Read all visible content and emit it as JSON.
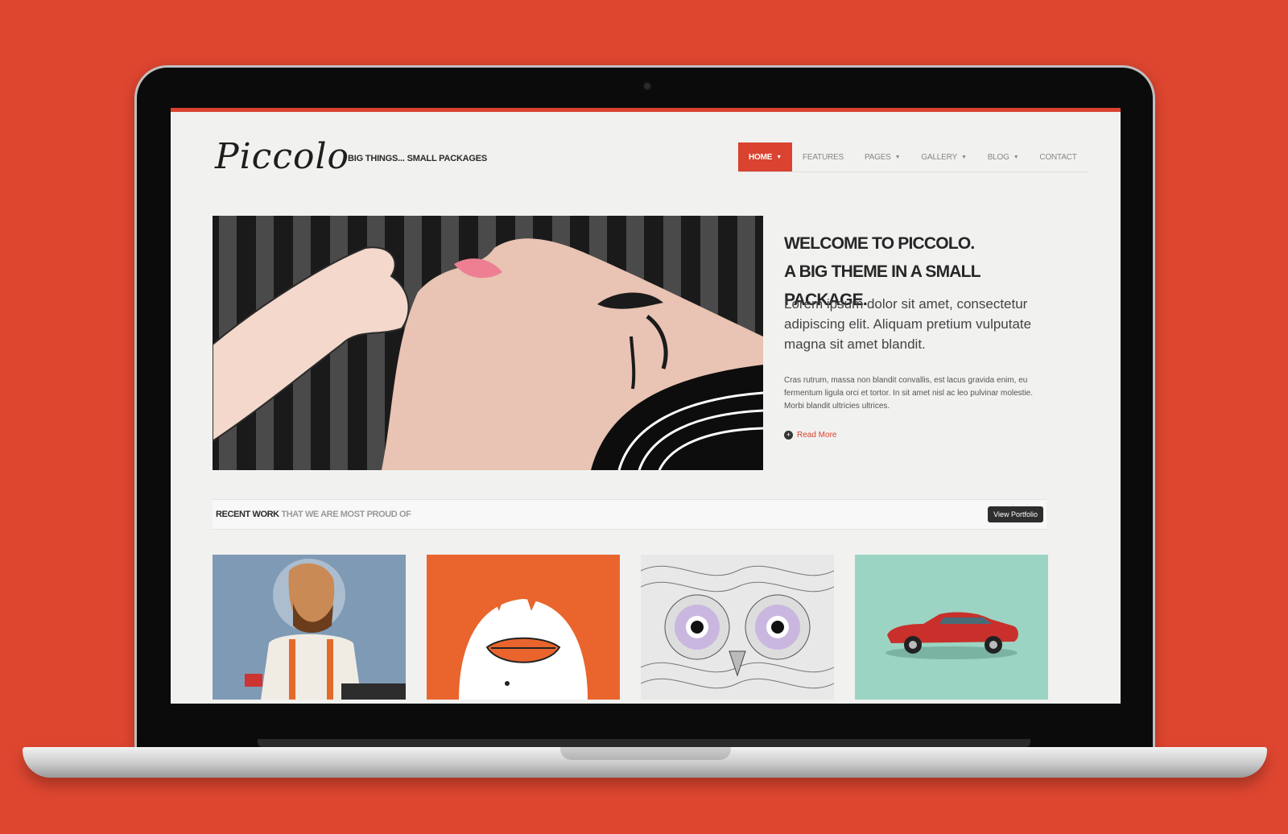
{
  "site": {
    "logo": "Piccolo",
    "tagline": "BIG THINGS... SMALL PACKAGES"
  },
  "nav": {
    "items": [
      {
        "label": "HOME",
        "active": true,
        "dropdown": true
      },
      {
        "label": "FEATURES",
        "active": false,
        "dropdown": false
      },
      {
        "label": "PAGES",
        "active": false,
        "dropdown": true
      },
      {
        "label": "GALLERY",
        "active": false,
        "dropdown": true
      },
      {
        "label": "BLOG",
        "active": false,
        "dropdown": true
      },
      {
        "label": "CONTACT",
        "active": false,
        "dropdown": false
      }
    ],
    "caret": "▼"
  },
  "hero": {
    "title_line1": "WELCOME TO PICCOLO.",
    "title_line2": "A BIG THEME IN A SMALL PACKAGE.",
    "lead": "Lorem ipsum dolor sit amet, consectetur adipiscing elit. Aliquam pretium vulputate magna sit amet blandit.",
    "body": "Cras rutrum, massa non blandit convallis, est lacus gravida enim, eu fermentum ligula orci et tortor. In sit amet nisl ac leo pulvinar molestie. Morbi blandit ultricies ultrices.",
    "read_more": "Read More",
    "read_more_icon": "+"
  },
  "recent": {
    "title": "RECENT WORK",
    "subtitle": "THAT WE ARE MOST PROUD OF",
    "button": "View Portfolio"
  },
  "colors": {
    "background": "#de4630",
    "accent": "#d9432f",
    "tile_teal": "#9bd4c3",
    "tile_orange": "#e9652d",
    "tile_blue": "#7f9ab4"
  }
}
